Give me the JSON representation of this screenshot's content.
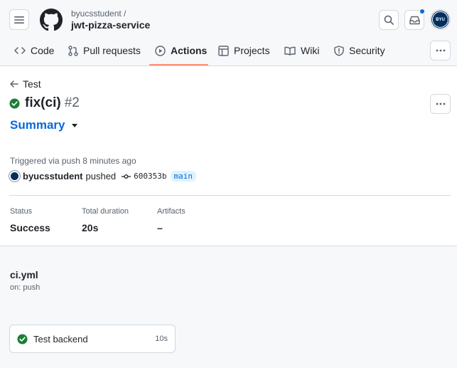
{
  "header": {
    "owner": "byucsstudent /",
    "repo": "jwt-pizza-service",
    "avatar_text": "BYU"
  },
  "tabs": [
    {
      "label": "Code",
      "icon": "code-icon",
      "active": false
    },
    {
      "label": "Pull requests",
      "icon": "pull-request-icon",
      "active": false
    },
    {
      "label": "Actions",
      "icon": "play-icon",
      "active": true
    },
    {
      "label": "Projects",
      "icon": "table-icon",
      "active": false
    },
    {
      "label": "Wiki",
      "icon": "book-icon",
      "active": false
    },
    {
      "label": "Security",
      "icon": "shield-icon",
      "active": false
    }
  ],
  "run": {
    "back_label": "Test",
    "name": "fix(ci)",
    "number": "#2",
    "summary_label": "Summary",
    "triggered_text": "Triggered via push 8 minutes ago",
    "user": "byucsstudent",
    "pushed_word": "pushed",
    "sha": "600353b",
    "branch": "main",
    "status_color": "#1a7f37"
  },
  "stats": {
    "status_label": "Status",
    "status_value": "Success",
    "duration_label": "Total duration",
    "duration_value": "20s",
    "artifacts_label": "Artifacts",
    "artifacts_value": "–"
  },
  "workflow": {
    "file": "ci.yml",
    "on": "on: push",
    "jobs": [
      {
        "name": "Test backend",
        "duration": "10s",
        "status": "success"
      }
    ]
  }
}
